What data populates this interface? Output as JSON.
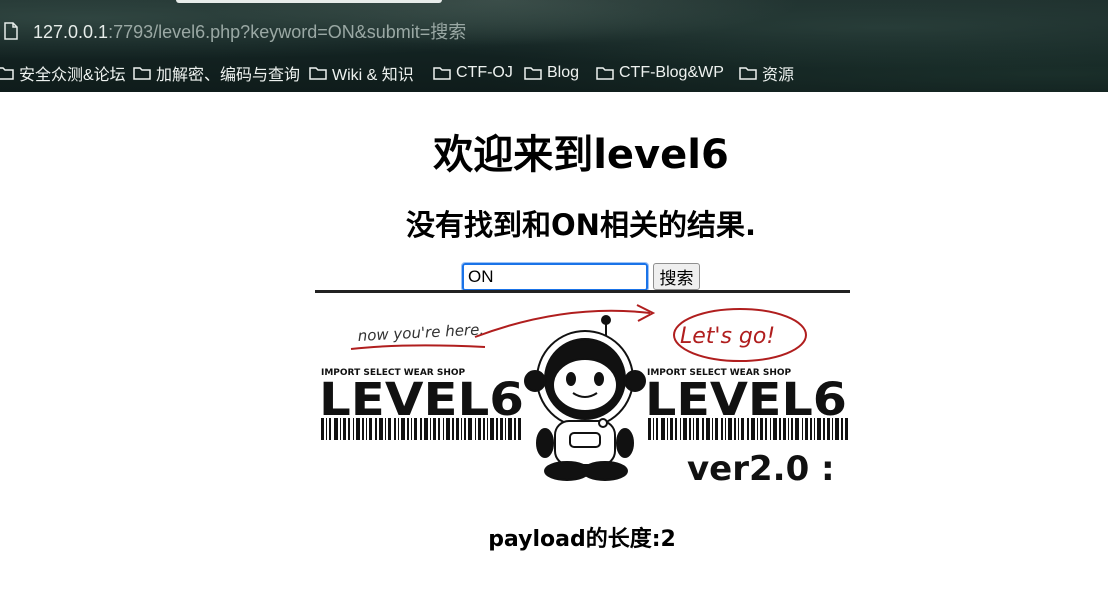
{
  "browser": {
    "url_host": "127.0.0.1",
    "url_rest": ":7793/level6.php?keyword=ON&submit=搜索",
    "bookmarks": [
      {
        "label": "安全众测&论坛"
      },
      {
        "label": "加解密、编码与查询"
      },
      {
        "label": "Wiki & 知识"
      },
      {
        "label": "CTF-OJ"
      },
      {
        "label": "Blog"
      },
      {
        "label": "CTF-Blog&WP"
      },
      {
        "label": "资源"
      }
    ]
  },
  "page": {
    "title": "欢迎来到level6",
    "result_text": "没有找到和ON相关的结果.",
    "search": {
      "value": "ON",
      "button_label": "搜索"
    },
    "banner": {
      "note_left": "now you're here.",
      "note_right": "Let's go!",
      "shop_left": "IMPORT SELECT WEAR SHOP",
      "level_left": "LEVEL6",
      "shop_right": "IMPORT SELECT WEAR SHOP",
      "level_right": "LEVEL6",
      "version": "ver2.0 :"
    },
    "payload_length": "payload的长度:2"
  },
  "colors": {
    "focus_border": "#1a73e8",
    "banner_red": "#b01e1e"
  }
}
